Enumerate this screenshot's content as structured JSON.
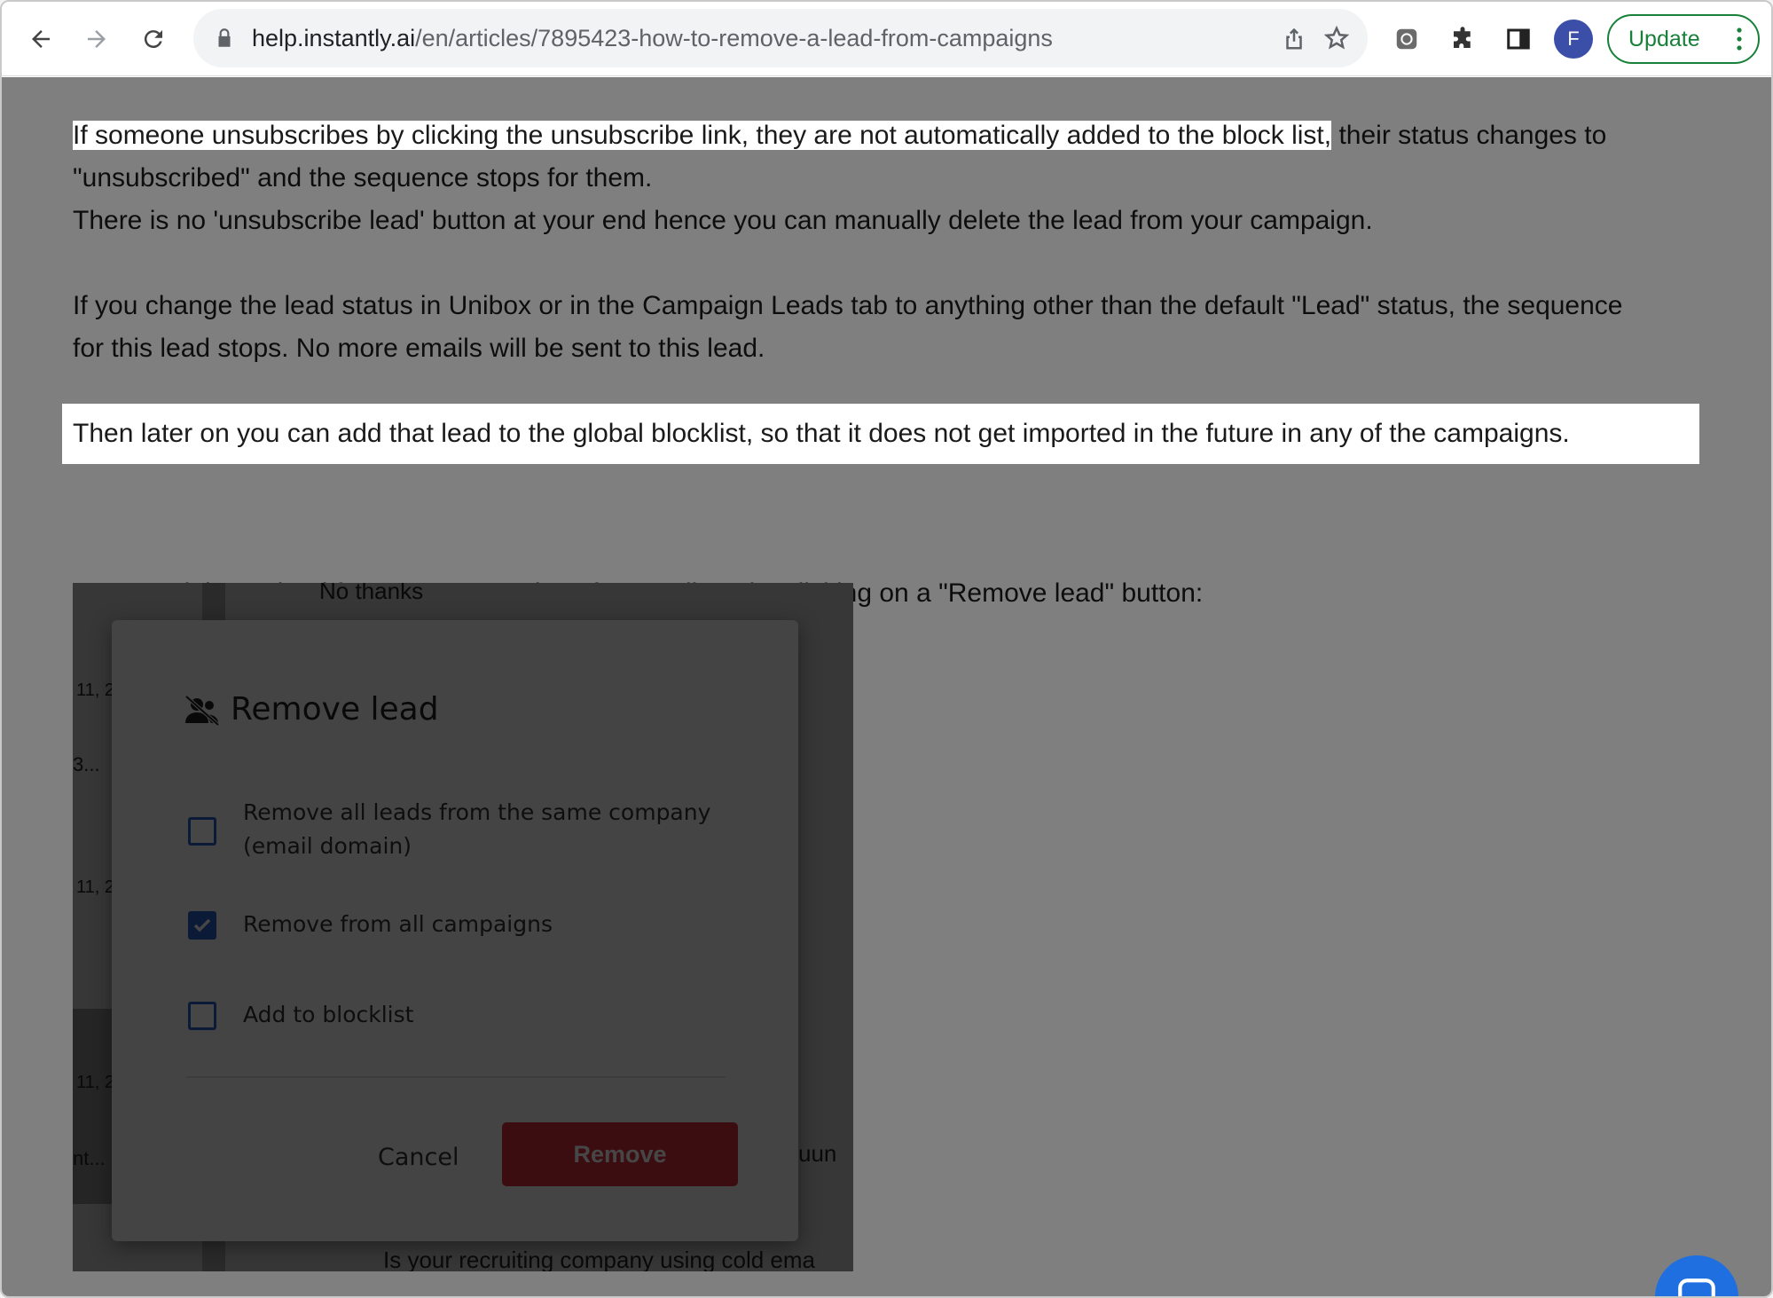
{
  "browser": {
    "url_host": "help.instantly.ai",
    "url_path": "/en/articles/7895423-how-to-remove-a-lead-from-campaigns",
    "avatar_letter": "F",
    "update_label": "Update"
  },
  "article": {
    "p1_highlight": "If someone unsubscribes by clicking the unsubscribe link, they are not automatically added to the block list,",
    "p1_rest": " their status changes to \"unsubscribed\" and the sequence stops for them.",
    "p2": "There is no 'unsubscribe lead' button at your end hence you can manually delete the lead from your campaign.",
    "p3": "If you change the lead status in Unibox or in the Campaign Leads tab to anything other than the default \"Lead\" status, the sequence for this lead stops. No more emails will be sent to this lead.",
    "p4": "Then later on you can add that lead to the global blocklist, so that it does not get imported in the future in any of the campaigns.",
    "p5": "You can delete a lead from your campaigns from Unibox, by clicking on a \"Remove lead\" button:"
  },
  "screenshot": {
    "bg_top": "No thanks",
    "bg_bottom": "Is your recruiting company using cold ema",
    "bg_side_1": "11, 2",
    "bg_side_2": "3...",
    "bg_side_3": "11, 2",
    "bg_side_4": "11, 2",
    "bg_side_5": "nt...",
    "bg_right": "uun",
    "dialog": {
      "title": "Remove lead",
      "option1": "Remove all leads from the same company (email domain)",
      "option1_checked": false,
      "option2": "Remove from all campaigns",
      "option2_checked": true,
      "option3": "Add to blocklist",
      "option3_checked": false,
      "cancel_label": "Cancel",
      "remove_label": "Remove"
    }
  },
  "icons": {
    "back": "arrow-left-icon",
    "forward": "arrow-right-icon",
    "reload": "reload-icon",
    "lock": "lock-icon",
    "share": "share-icon",
    "bookmark": "star-icon",
    "extension": "puzzle-icon",
    "sidepanel": "side-panel-icon",
    "chat": "chat-icon"
  },
  "colors": {
    "accent_blue": "#2a63c9",
    "remove_red": "#d9303e",
    "update_green": "#188038",
    "chat_blue": "#1f6fe0"
  }
}
